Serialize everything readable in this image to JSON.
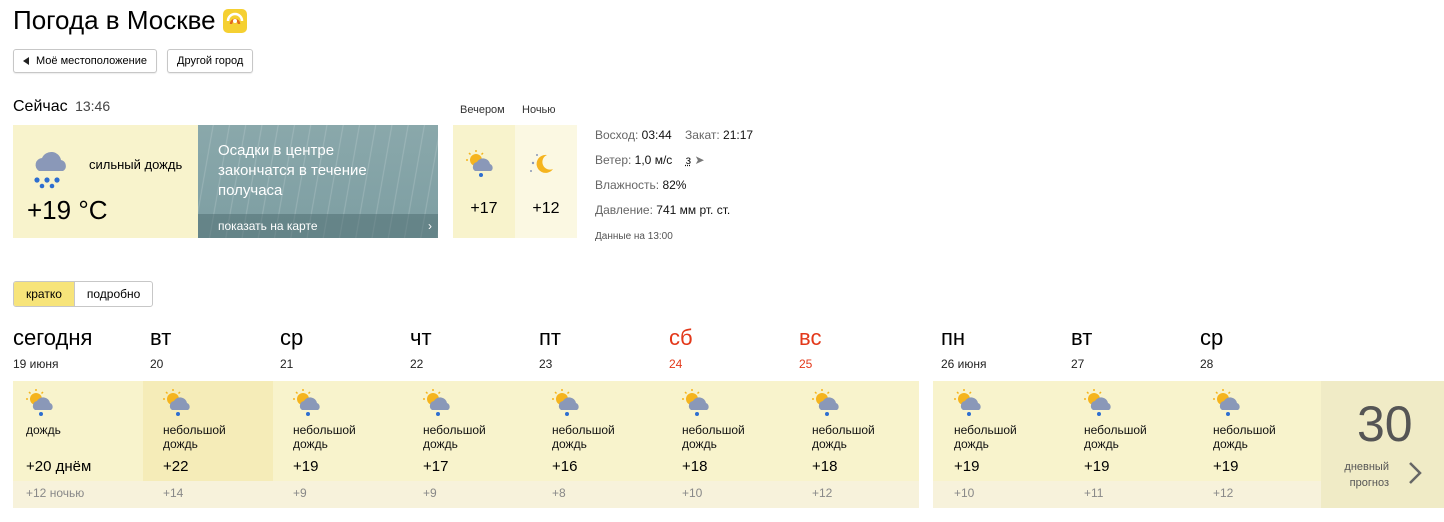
{
  "header": {
    "title": "Погода в Москве"
  },
  "buttons": {
    "my_location": "Моё местоположение",
    "other_city": "Другой город"
  },
  "now": {
    "label": "Сейчас",
    "time": "13:46",
    "condition": "сильный дождь",
    "temperature": "+19 °C",
    "icon": "heavy-rain-cloud-icon",
    "radar_message": "Осадки в центре закончатся в течение получаса",
    "map_link": "показать на карте"
  },
  "periods": [
    {
      "label": "Вечером",
      "temp": "+17",
      "icon": "sun-cloud-rain-icon"
    },
    {
      "label": "Ночью",
      "temp": "+12",
      "icon": "moon-stars-icon"
    }
  ],
  "details": {
    "sunrise_label": "Восход:",
    "sunrise": "03:44",
    "sunset_label": "Закат:",
    "sunset": "21:17",
    "wind_label": "Ветер:",
    "wind": "1,0 м/с",
    "wind_dir": "з",
    "humidity_label": "Влажность:",
    "humidity": "82%",
    "pressure_label": "Давление:",
    "pressure": "741 мм рт. ст.",
    "data_note": "Данные на 13:00"
  },
  "tabs": {
    "brief": "кратко",
    "detailed": "подробно"
  },
  "days": [
    {
      "name": "сегодня",
      "date": "19 июня",
      "cond1": "дождь",
      "cond2": "",
      "day": "+20 днём",
      "night": "+12 ночью",
      "weekend": false
    },
    {
      "name": "вт",
      "date": "20",
      "cond1": "небольшой",
      "cond2": "дождь",
      "day": "+22",
      "night": "+14",
      "weekend": false
    },
    {
      "name": "ср",
      "date": "21",
      "cond1": "небольшой",
      "cond2": "дождь",
      "day": "+19",
      "night": "+9",
      "weekend": false
    },
    {
      "name": "чт",
      "date": "22",
      "cond1": "небольшой",
      "cond2": "дождь",
      "day": "+17",
      "night": "+9",
      "weekend": false
    },
    {
      "name": "пт",
      "date": "23",
      "cond1": "небольшой",
      "cond2": "дождь",
      "day": "+16",
      "night": "+8",
      "weekend": false
    },
    {
      "name": "сб",
      "date": "24",
      "cond1": "небольшой",
      "cond2": "дождь",
      "day": "+18",
      "night": "+10",
      "weekend": true
    },
    {
      "name": "вс",
      "date": "25",
      "cond1": "небольшой",
      "cond2": "дождь",
      "day": "+18",
      "night": "+12",
      "weekend": true
    },
    {
      "name": "пн",
      "date": "26 июня",
      "cond1": "небольшой",
      "cond2": "дождь",
      "day": "+19",
      "night": "+10",
      "weekend": false
    },
    {
      "name": "вт",
      "date": "27",
      "cond1": "небольшой",
      "cond2": "дождь",
      "day": "+19",
      "night": "+11",
      "weekend": false
    },
    {
      "name": "ср",
      "date": "28",
      "cond1": "небольшой",
      "cond2": "дождь",
      "day": "+19",
      "night": "+12",
      "weekend": false
    }
  ],
  "forecast30": {
    "number": "30",
    "line1": "дневный",
    "line2": "прогноз"
  },
  "colors": {
    "card_bg": "#f8f3cc",
    "weekend": "#e3381a",
    "tab_active": "#f7e47a"
  }
}
